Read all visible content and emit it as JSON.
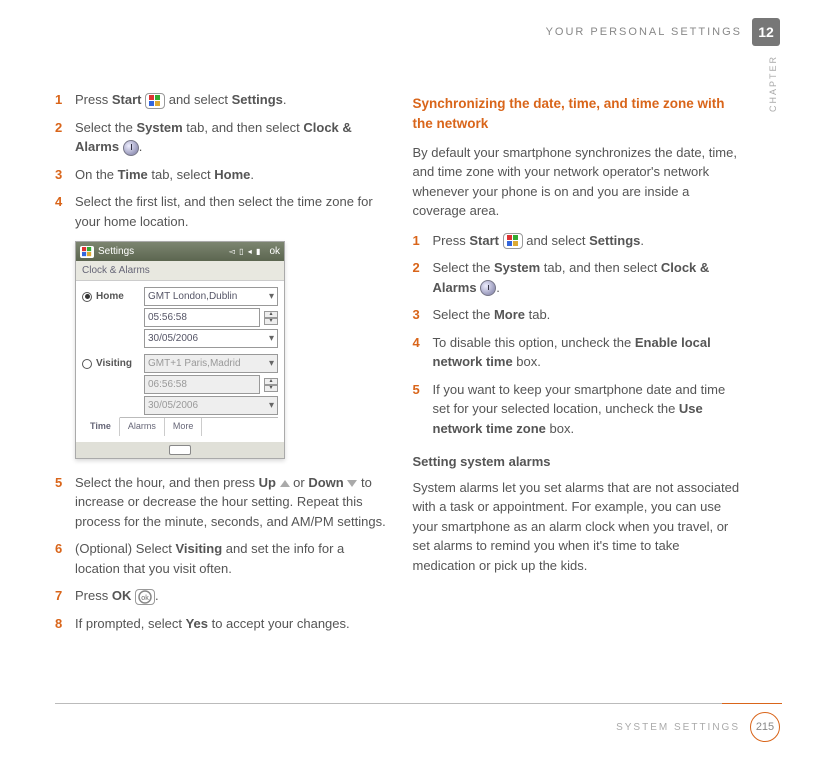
{
  "header": {
    "title": "YOUR PERSONAL SETTINGS",
    "chapter_num": "12",
    "chapter_label": "CHAPTER"
  },
  "footer": {
    "title": "SYSTEM SETTINGS",
    "page": "215"
  },
  "left": {
    "s1": {
      "n": "1",
      "a": "Press ",
      "b1": "Start",
      "b": " and select ",
      "b2": "Settings",
      "c": "."
    },
    "s2": {
      "n": "2",
      "a": "Select the ",
      "b1": "System",
      "b": " tab, and then select ",
      "b2": "Clock & Alarms",
      "c": "."
    },
    "s3": {
      "n": "3",
      "a": "On the ",
      "b1": "Time",
      "b": " tab, select ",
      "b2": "Home",
      "c": "."
    },
    "s4": {
      "n": "4",
      "a": "Select the first list, and then select the time zone for your home location."
    },
    "s5": {
      "n": "5",
      "a": "Select the hour, and then press ",
      "b1": "Up",
      "b": " or ",
      "b2": "Down",
      "c": " to increase or decrease the hour setting. Repeat this process for the minute, seconds, and AM/PM settings."
    },
    "s6": {
      "n": "6",
      "a": "(Optional)  Select ",
      "b1": "Visiting",
      "b": " and set the info for a location that you visit often."
    },
    "s7": {
      "n": "7",
      "a": "Press ",
      "b1": "OK",
      "c": "."
    },
    "s8": {
      "n": "8",
      "a": "If prompted, select ",
      "b1": "Yes",
      "b": " to accept your changes."
    }
  },
  "right": {
    "h1": "Synchronizing the date, time, and time zone with the network",
    "p1": "By default your smartphone synchronizes the date, time, and time zone with your network operator's network whenever your phone is on and you are inside a coverage area.",
    "s1": {
      "n": "1",
      "a": "Press ",
      "b1": "Start",
      "b": " and select ",
      "b2": "Settings",
      "c": "."
    },
    "s2": {
      "n": "2",
      "a": "Select the ",
      "b1": "System",
      "b": " tab, and then select ",
      "b2": "Clock & Alarms",
      "c": "."
    },
    "s3": {
      "n": "3",
      "a": "Select the ",
      "b1": "More",
      "b": " tab."
    },
    "s4": {
      "n": "4",
      "a": "To disable this option, uncheck the ",
      "b1": "Enable local network time",
      "b": " box."
    },
    "s5": {
      "n": "5",
      "a": "If you want to keep your smartphone date and time set for your selected location, uncheck the ",
      "b1": "Use network time zone",
      "b": " box."
    },
    "h2": "Setting system alarms",
    "p2": "System alarms let you set alarms that are not associated with a task or appointment. For example, you can use your smartphone as an alarm clock when you travel, or set alarms to remind you when it's time to take medication or pick up the kids."
  },
  "shot": {
    "title": "Settings",
    "status": "◅ ▯ ◂ ▮",
    "ok": "ok",
    "sub": "Clock & Alarms",
    "home_label": "Home",
    "visiting_label": "Visiting",
    "tz1": "GMT London,Dublin",
    "time1": "05:56:58",
    "date1": "30/05/2006",
    "tz2": "GMT+1 Paris,Madrid",
    "time2": "06:56:58",
    "date2": "30/05/2006",
    "tab_time": "Time",
    "tab_alarms": "Alarms",
    "tab_more": "More"
  }
}
